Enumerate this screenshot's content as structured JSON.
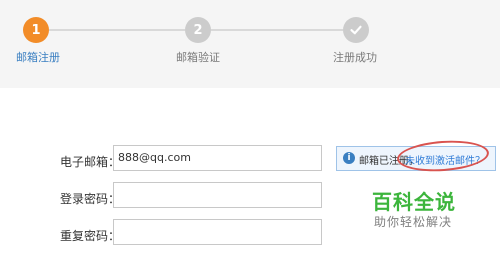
{
  "steps": [
    {
      "number": "1",
      "label": "邮箱注册",
      "color": "#f28c28"
    },
    {
      "number": "2",
      "label": "邮箱验证",
      "color": "#cccccc"
    },
    {
      "label": "注册成功",
      "color": "#cccccc",
      "icon": "check-icon"
    }
  ],
  "form": {
    "email": {
      "label": "电子邮箱：",
      "value": "888@qq.com"
    },
    "password": {
      "label": "登录密码："
    },
    "confirm_password": {
      "label": "重复密码："
    }
  },
  "tip": {
    "icon": "info-icon",
    "icon_glyph": "i",
    "text": "邮箱已注册，",
    "link_text": "未收到激活邮件？",
    "icon_color": "#3a7fc1",
    "link_color": "#2f7bd6"
  },
  "annotation": {
    "color": "#d9534f"
  },
  "watermark": {
    "title": "百科全说",
    "subtitle": "助你轻松解决",
    "title_color": "#3cb53c"
  }
}
